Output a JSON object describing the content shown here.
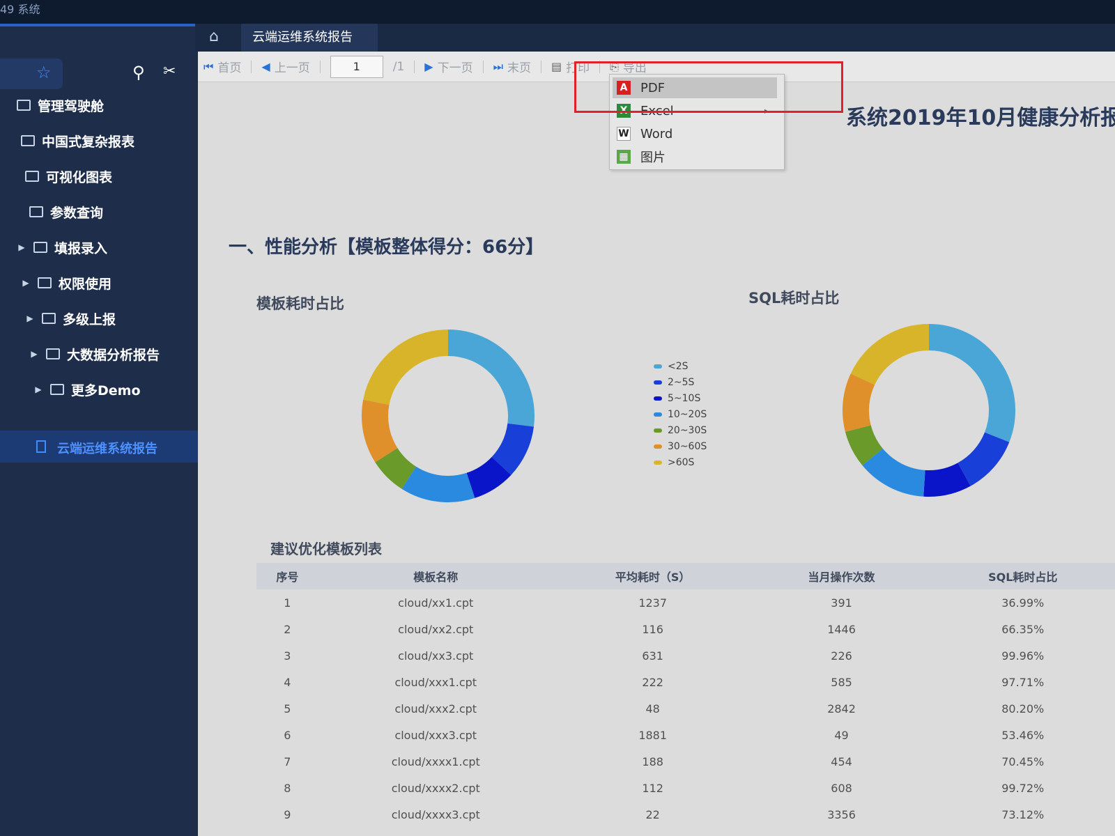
{
  "app": {
    "title": "49 系统"
  },
  "tabs": {
    "active": "云端运维系统报告"
  },
  "sidebar": {
    "items": [
      {
        "label": "管理驾驶舱",
        "arrow": false
      },
      {
        "label": "中国式复杂报表",
        "arrow": false
      },
      {
        "label": "可视化图表",
        "arrow": false
      },
      {
        "label": "参数查询",
        "arrow": false
      },
      {
        "label": "填报录入",
        "arrow": true
      },
      {
        "label": "权限使用",
        "arrow": true
      },
      {
        "label": "多级上报",
        "arrow": true
      },
      {
        "label": "大数据分析报告",
        "arrow": true
      },
      {
        "label": "更多Demo",
        "arrow": true
      }
    ],
    "active": "云端运维系统报告"
  },
  "toolbar": {
    "first": "首页",
    "prev": "上一页",
    "page": "1",
    "total": "/1",
    "next": "下一页",
    "last": "末页",
    "print": "打印",
    "export": "导出"
  },
  "export_menu": {
    "items": [
      {
        "label": "PDF",
        "icon": "pdf-icon",
        "highlighted": true
      },
      {
        "label": "Excel",
        "icon": "excel-icon",
        "submenu": true
      },
      {
        "label": "Word",
        "icon": "word-icon"
      },
      {
        "label": "图片",
        "icon": "image-icon"
      }
    ]
  },
  "report": {
    "title": "系统2019年10月健康分析报",
    "section1": "一、性能分析【模板整体得分：66分】",
    "chart_left_title": "模板耗时占比",
    "chart_right_title": "SQL耗时占比",
    "table_title": "建议优化模板列表"
  },
  "chart_data": [
    {
      "type": "pie",
      "title": "模板耗时占比",
      "categories": [
        "<2S",
        "2~5S",
        "5~10S",
        "10~20S",
        "20~30S",
        "30~60S",
        ">60S"
      ],
      "values": [
        27,
        10,
        8,
        14,
        7,
        12,
        22
      ],
      "colors": [
        "#4aa6d6",
        "#1840d8",
        "#0a14c8",
        "#2a8ae0",
        "#6a9a2a",
        "#e0902a",
        "#d8b42a"
      ],
      "legend": "center"
    },
    {
      "type": "pie",
      "title": "SQL耗时占比",
      "categories": [
        "<2S",
        "2~5S",
        "5~10S",
        "10~20S",
        "20~30S",
        "30~60S",
        ">60S"
      ],
      "values": [
        31,
        11,
        9,
        13,
        7,
        11,
        18
      ],
      "colors": [
        "#4aa6d6",
        "#1840d8",
        "#0a14c8",
        "#2a8ae0",
        "#6a9a2a",
        "#e0902a",
        "#d8b42a"
      ],
      "legend": "center"
    }
  ],
  "table": {
    "columns": [
      "序号",
      "模板名称",
      "平均耗时（S）",
      "当月操作次数",
      "SQL耗时占比"
    ],
    "rows": [
      [
        "1",
        "cloud/xx1.cpt",
        "1237",
        "391",
        "36.99%"
      ],
      [
        "2",
        "cloud/xx2.cpt",
        "116",
        "1446",
        "66.35%"
      ],
      [
        "3",
        "cloud/xx3.cpt",
        "631",
        "226",
        "99.96%"
      ],
      [
        "4",
        "cloud/xxx1.cpt",
        "222",
        "585",
        "97.71%"
      ],
      [
        "5",
        "cloud/xxx2.cpt",
        "48",
        "2842",
        "80.20%"
      ],
      [
        "6",
        "cloud/xxx3.cpt",
        "1881",
        "49",
        "53.46%"
      ],
      [
        "7",
        "cloud/xxxx1.cpt",
        "188",
        "454",
        "70.45%"
      ],
      [
        "8",
        "cloud/xxxx2.cpt",
        "112",
        "608",
        "99.72%"
      ],
      [
        "9",
        "cloud/xxxx3.cpt",
        "22",
        "3356",
        "73.12%"
      ]
    ]
  }
}
